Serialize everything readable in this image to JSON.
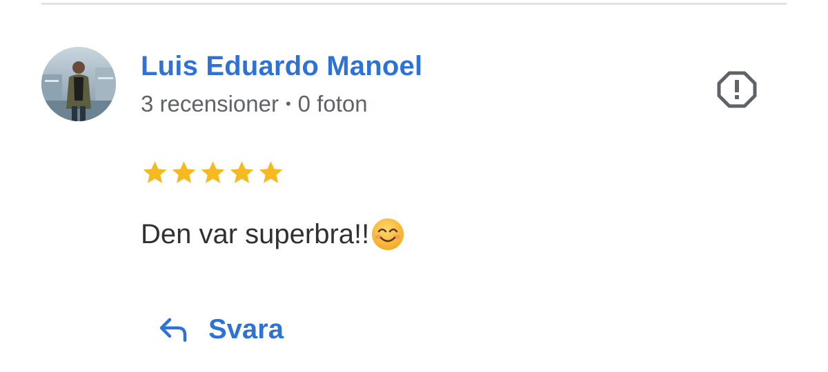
{
  "reviewer": {
    "name": "Luis Eduardo Manoel",
    "reviews_count": "3 recensioner",
    "separator": "•",
    "photos_count": "0 foton",
    "avatar_icon": "user-avatar-photo"
  },
  "report": {
    "icon": "report-octagon-icon"
  },
  "review": {
    "rating": 5,
    "rating_max": 5,
    "text": "Den var superbra!!",
    "emoji_icon": "smiling-face-emoji"
  },
  "reply": {
    "label": "Svara",
    "icon": "reply-arrow-icon"
  },
  "colors": {
    "link_blue": "#2f72d6",
    "star_gold": "#f6b91f",
    "meta_gray": "#5f6368",
    "text_dark": "#303134",
    "divider": "#e2e2e2"
  }
}
